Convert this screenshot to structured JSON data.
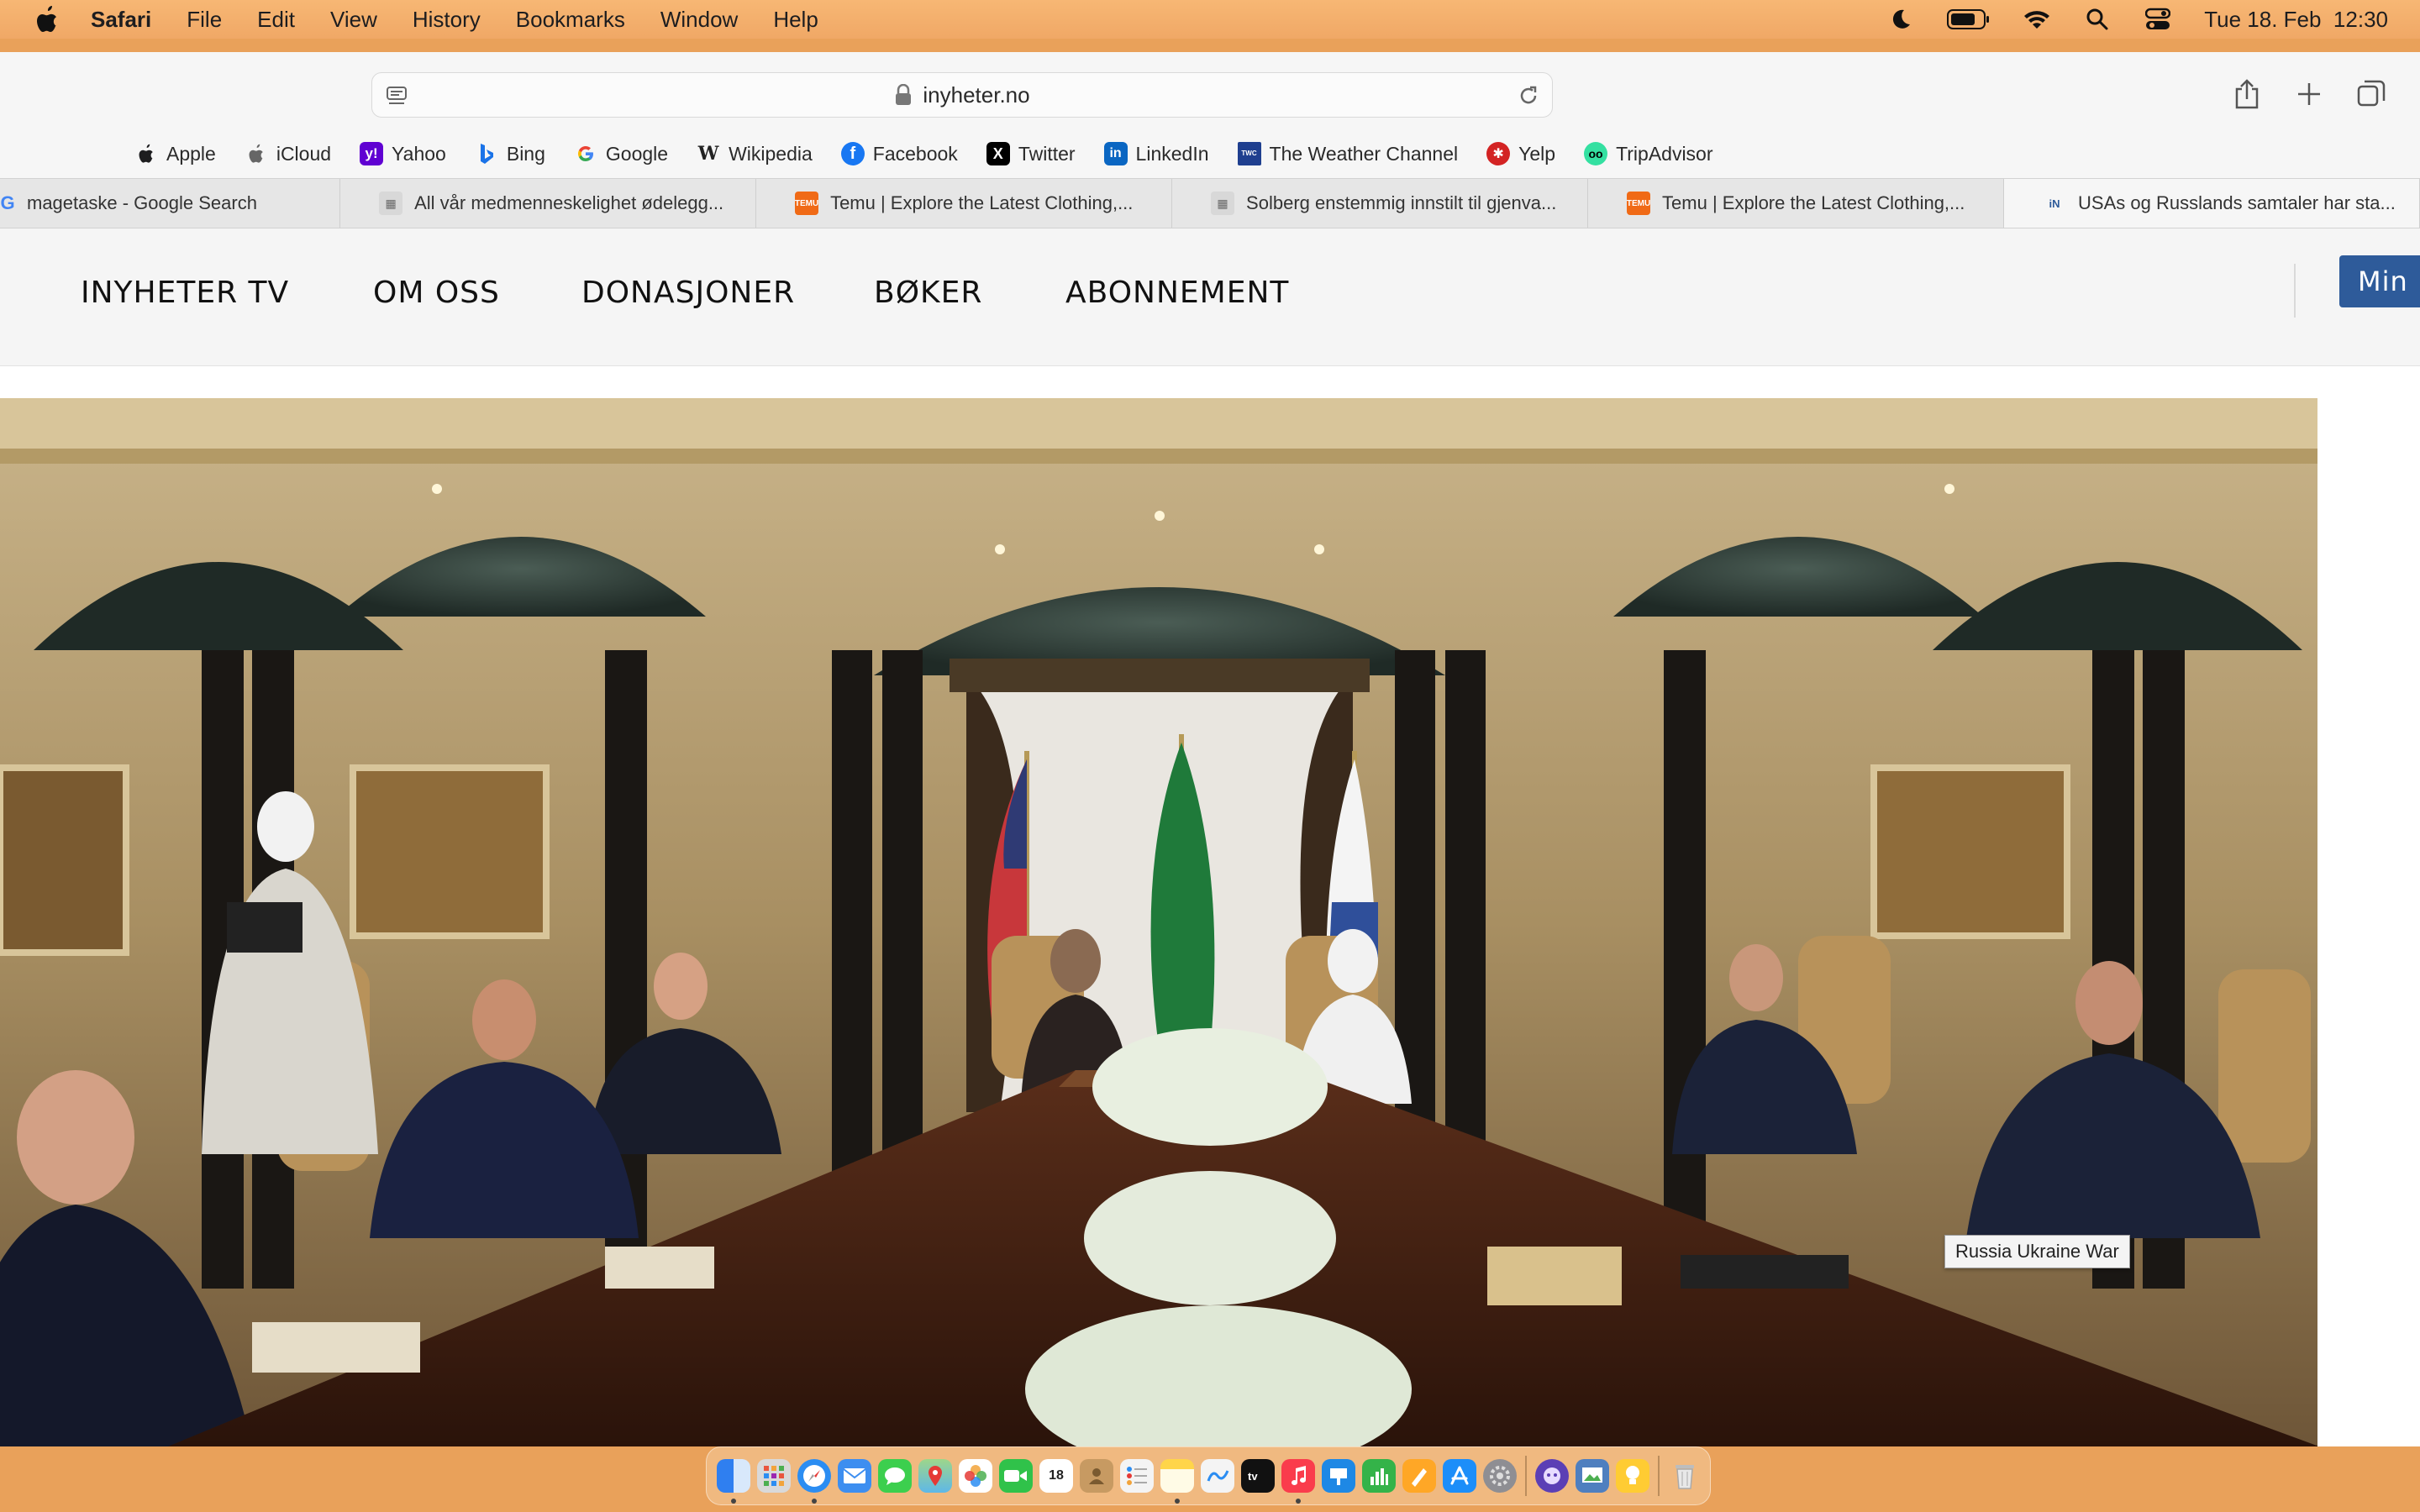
{
  "menubar": {
    "app_name": "Safari",
    "menus": [
      "File",
      "Edit",
      "View",
      "History",
      "Bookmarks",
      "Window",
      "Help"
    ],
    "datetime": "Tue 18. Feb  12:30",
    "status_icons": [
      "moon-icon",
      "battery-icon",
      "wifi-icon",
      "spotlight-search-icon",
      "control-center-icon"
    ]
  },
  "toolbar": {
    "url": "inyheter.no"
  },
  "favorites": [
    {
      "label": "Apple",
      "icon": "apple-icon",
      "color": "#1d1d1f"
    },
    {
      "label": "iCloud",
      "icon": "apple-icon",
      "color": "#555555"
    },
    {
      "label": "Yahoo",
      "icon": "yahoo-icon",
      "color": "#6001d2"
    },
    {
      "label": "Bing",
      "icon": "bing-icon",
      "color": "#1a73e8"
    },
    {
      "label": "Google",
      "icon": "google-icon",
      "color": "#ea4335"
    },
    {
      "label": "Wikipedia",
      "icon": "wikipedia-icon",
      "color": "#222222"
    },
    {
      "label": "Facebook",
      "icon": "facebook-icon",
      "color": "#1877f2"
    },
    {
      "label": "Twitter",
      "icon": "x-icon",
      "color": "#000000"
    },
    {
      "label": "LinkedIn",
      "icon": "linkedin-icon",
      "color": "#0a66c2"
    },
    {
      "label": "The Weather Channel",
      "icon": "weather-channel-icon",
      "color": "#1f3f8f"
    },
    {
      "label": "Yelp",
      "icon": "yelp-icon",
      "color": "#d32323"
    },
    {
      "label": "TripAdvisor",
      "icon": "tripadvisor-icon",
      "color": "#34e0a1"
    }
  ],
  "tabs": [
    {
      "title": "magetaske - Google Search",
      "icon": "google-icon",
      "icon_color": "#4285f4"
    },
    {
      "title": "All vår medmenneskelighet ødelegg...",
      "icon": "site-icon",
      "icon_color": "#8a8a8a"
    },
    {
      "title": "Temu | Explore the Latest Clothing,...",
      "icon": "temu-icon",
      "icon_color": "#f06a16"
    },
    {
      "title": "Solberg enstemmig innstilt til gjenva...",
      "icon": "site-icon",
      "icon_color": "#8a8a8a"
    },
    {
      "title": "Temu | Explore the Latest Clothing,...",
      "icon": "temu-icon",
      "icon_color": "#f06a16"
    },
    {
      "title": "USAs og Russlands samtaler har sta...",
      "icon": "inyheter-icon",
      "icon_color": "#2e5b9a"
    }
  ],
  "site": {
    "nav": [
      "INYHETER TV",
      "OM OSS",
      "DONASJONER",
      "BØKER",
      "ABONNEMENT"
    ],
    "account_button": "Min",
    "accent": "#2e5b9a",
    "photo_tooltip": "Russia Ukraine War"
  },
  "dock": {
    "apps": [
      {
        "name": "finder",
        "color": "#3b8ff0",
        "running": true
      },
      {
        "name": "launchpad",
        "color": "#e9553e",
        "running": false
      },
      {
        "name": "safari",
        "color": "#2b8df2",
        "running": true
      },
      {
        "name": "mail",
        "color": "#3d8ef0",
        "running": false
      },
      {
        "name": "messages",
        "color": "#3ccf4e",
        "running": false
      },
      {
        "name": "maps",
        "color": "#4caf50",
        "running": false
      },
      {
        "name": "photos",
        "color": "#f2994a",
        "running": false
      },
      {
        "name": "facetime",
        "color": "#30c24a",
        "running": false
      },
      {
        "name": "calendar",
        "color": "#ffffff",
        "running": false,
        "label": "18"
      },
      {
        "name": "contacts",
        "color": "#c79a62",
        "running": false
      },
      {
        "name": "reminders",
        "color": "#f4f4f4",
        "running": false
      },
      {
        "name": "notes",
        "color": "#ffd54a",
        "running": true
      },
      {
        "name": "freeform",
        "color": "#f4f4f4",
        "running": false
      },
      {
        "name": "tv",
        "color": "#111111",
        "running": false
      },
      {
        "name": "music",
        "color": "#fa3c4c",
        "running": true
      },
      {
        "name": "keynote",
        "color": "#1e88e5",
        "running": false
      },
      {
        "name": "numbers",
        "color": "#34b349",
        "running": false
      },
      {
        "name": "pages",
        "color": "#ffa726",
        "running": false
      },
      {
        "name": "app-store",
        "color": "#1c8ef9",
        "running": false
      },
      {
        "name": "system-settings",
        "color": "#8e8e93",
        "running": false
      }
    ],
    "recent_apps": [
      {
        "name": "assistant",
        "color": "#5b3fb5"
      },
      {
        "name": "preview",
        "color": "#4f7fbf"
      },
      {
        "name": "tips",
        "color": "#ffcc33"
      }
    ],
    "trash": {
      "name": "trash",
      "color": "#d9d9d9"
    }
  }
}
